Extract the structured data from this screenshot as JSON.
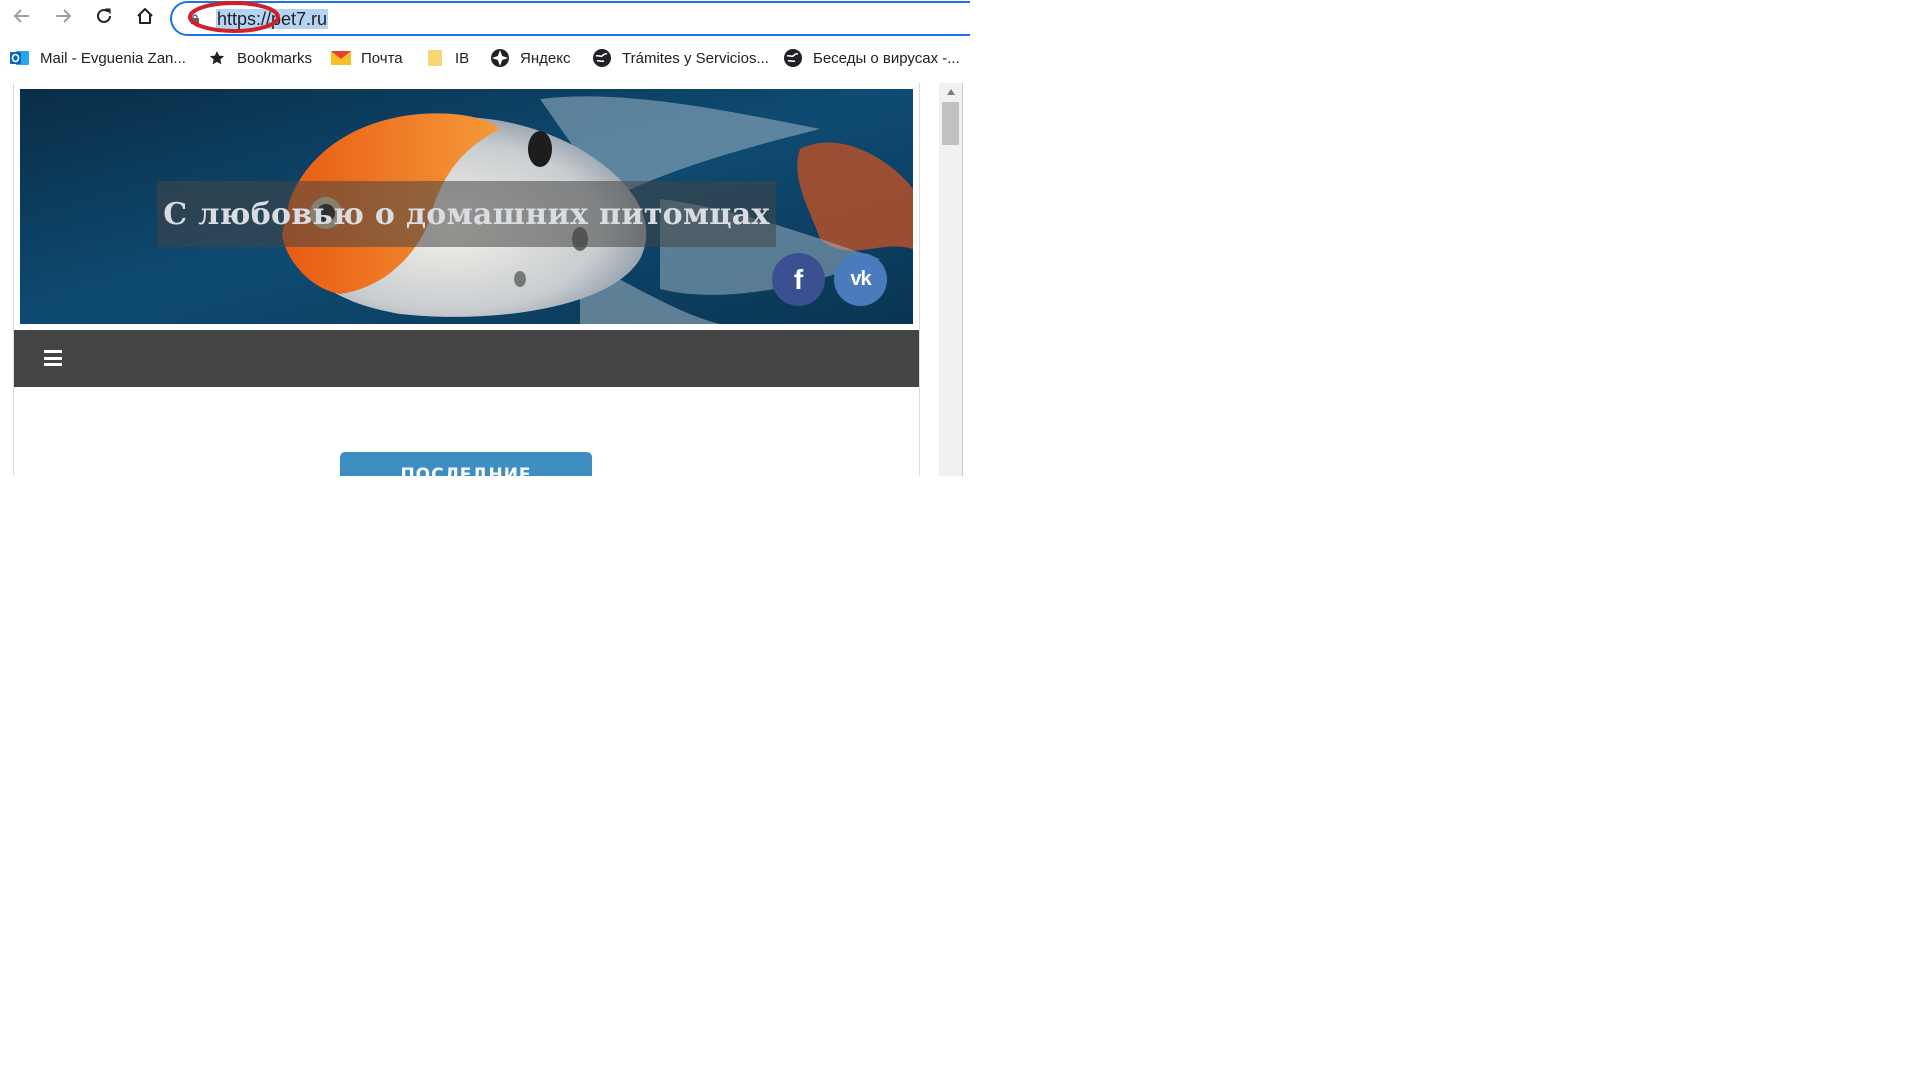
{
  "browser": {
    "url": "https://pet7.ru",
    "nav": {
      "back": "back-arrow-icon",
      "forward": "forward-arrow-icon",
      "reload": "reload-icon",
      "home": "home-icon"
    },
    "annotation_color": "#d0202a",
    "url_highlight_color": "#b5d3f3"
  },
  "bookmarks": [
    {
      "label": "Mail - Evguenia Zan...",
      "icon": "outlook-icon"
    },
    {
      "label": "Bookmarks",
      "icon": "star-icon"
    },
    {
      "label": "Почта",
      "icon": "mail-envelope-icon"
    },
    {
      "label": "IB",
      "icon": "folder-icon"
    },
    {
      "label": "Яндекс",
      "icon": "globe-icon"
    },
    {
      "label": "Trámites y Servicios...",
      "icon": "globe-icon"
    },
    {
      "label": "Беседы о вирусах -...",
      "icon": "globe-icon"
    }
  ],
  "page": {
    "hero_title": "С любовью о домашних питомцах",
    "social": {
      "facebook_label": "f",
      "vk_label": "vk"
    },
    "latest_button": "ПОСЛЕДНИЕ",
    "colors": {
      "menu_bar": "#444444",
      "facebook": "#3b5090",
      "vk": "#4a7bbd",
      "latest_button": "#3e8ec4"
    }
  }
}
